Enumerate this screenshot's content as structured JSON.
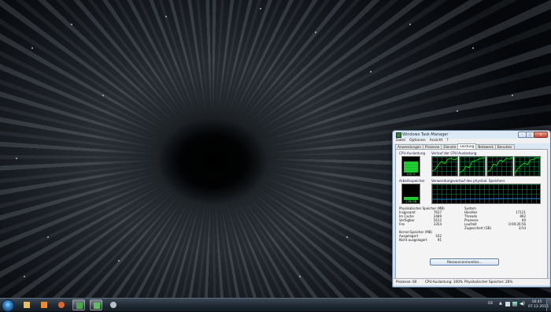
{
  "window": {
    "title": "Windows Task-Manager",
    "min_label": "–",
    "max_label": "□",
    "close_label": "✕",
    "menu": [
      "Datei",
      "Optionen",
      "Ansicht",
      "?"
    ],
    "tabs": [
      "Anwendungen",
      "Prozesse",
      "Dienste",
      "Leistung",
      "Netzwerk",
      "Benutzer"
    ],
    "active_tab": "Leistung"
  },
  "performance": {
    "cpu_label": "CPU-Auslastung",
    "cpu_value": "100 %",
    "cpu_fraction": 1.0,
    "cpu_history_label": "Verlauf der CPU-Auslastung",
    "memory_label": "Arbeitsspeicher",
    "memory_value": "1,96 GB",
    "memory_fraction": 0.26,
    "memory_history_label": "Verwendungsverlauf des physikal. Speichers",
    "physical_memory": {
      "header": "Physikalischer Speicher (MB)",
      "rows": [
        {
          "label": "Insgesamt",
          "value": "7637"
        },
        {
          "label": "Im Cache",
          "value": "2489"
        },
        {
          "label": "Verfügbar",
          "value": "5612"
        },
        {
          "label": "Frei",
          "value": "3354"
        }
      ]
    },
    "system": {
      "header": "System",
      "rows": [
        {
          "label": "Handles",
          "value": "17121"
        },
        {
          "label": "Threads",
          "value": "892"
        },
        {
          "label": "Prozesse",
          "value": "60"
        },
        {
          "label": "Laufzeit",
          "value": "0:00:26:56"
        },
        {
          "label": "Zugesichert (GB)",
          "value": "2/14"
        }
      ]
    },
    "kernel_memory": {
      "header": "Kernel-Speicher (MB)",
      "rows": [
        {
          "label": "Ausgelagert",
          "value": "162"
        },
        {
          "label": "Nicht ausgelagert",
          "value": "91"
        }
      ]
    },
    "resource_monitor_button": "Ressourcenmonitor..."
  },
  "statusbar": {
    "processes": "Prozesse: 60",
    "cpu": "CPU-Auslastung: 100%",
    "memory": "Physikalischer Speicher: 26%"
  },
  "taskbar": {
    "language": "DE",
    "tray_arrow": "▲",
    "volume_glyph": "◀)",
    "time": "16:45",
    "date": "07.12.2015",
    "pinned": [
      {
        "name": "explorer-icon",
        "color": "#e8c260"
      },
      {
        "name": "media-player-icon",
        "color": "#f08a2a"
      },
      {
        "name": "firefox-icon",
        "color": "#e0662a"
      },
      {
        "name": "solitaire-icon",
        "color": "#4aa84a"
      },
      {
        "name": "task-manager-icon",
        "color": "#5fbf5f"
      },
      {
        "name": "app-icon",
        "color": "#b8c0c8"
      }
    ]
  },
  "colors": {
    "graph_line": "#00ff00",
    "memory_line": "#2a7fff",
    "grid": "#008040"
  }
}
